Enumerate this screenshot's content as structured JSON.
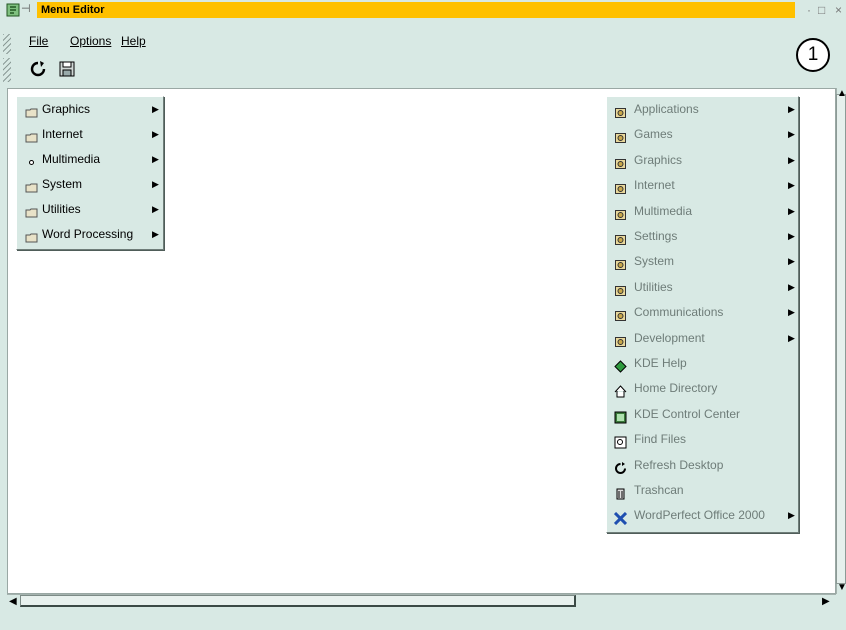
{
  "window": {
    "title": "Menu Editor",
    "buttons": {
      "minimize": "·",
      "maximize": "□",
      "close": "×"
    }
  },
  "menubar": {
    "file": "File",
    "options": "Options",
    "help": "Help"
  },
  "toolbar": {
    "refresh_icon": "refresh-icon",
    "save_icon": "save-icon"
  },
  "annotation_badge": "1",
  "left_menu": {
    "items": [
      {
        "label": "Graphics",
        "icon": "folder-icon"
      },
      {
        "label": "Internet",
        "icon": "folder-icon"
      },
      {
        "label": "Multimedia",
        "icon": "bullet-icon"
      },
      {
        "label": "System",
        "icon": "folder-icon"
      },
      {
        "label": "Utilities",
        "icon": "folder-icon"
      },
      {
        "label": "Word Processing",
        "icon": "folder-icon"
      }
    ]
  },
  "right_menu": {
    "items": [
      {
        "label": "Applications",
        "icon": "applications-icon",
        "submenu": true
      },
      {
        "label": "Games",
        "icon": "games-icon",
        "submenu": true
      },
      {
        "label": "Graphics",
        "icon": "graphics-icon",
        "submenu": true
      },
      {
        "label": "Internet",
        "icon": "internet-icon",
        "submenu": true
      },
      {
        "label": "Multimedia",
        "icon": "multimedia-icon",
        "submenu": true
      },
      {
        "label": "Settings",
        "icon": "settings-icon",
        "submenu": true
      },
      {
        "label": "System",
        "icon": "system-icon",
        "submenu": true
      },
      {
        "label": "Utilities",
        "icon": "utilities-icon",
        "submenu": true
      },
      {
        "label": "Communications",
        "icon": "communications-icon",
        "submenu": true
      },
      {
        "label": "Development",
        "icon": "development-icon",
        "submenu": true
      },
      {
        "label": "KDE Help",
        "icon": "help-icon",
        "submenu": false
      },
      {
        "label": "Home Directory",
        "icon": "home-icon",
        "submenu": false
      },
      {
        "label": "KDE Control Center",
        "icon": "control-center-icon",
        "submenu": false
      },
      {
        "label": "Find Files",
        "icon": "find-icon",
        "submenu": false
      },
      {
        "label": "Refresh Desktop",
        "icon": "refresh-icon",
        "submenu": false
      },
      {
        "label": "Trashcan",
        "icon": "trash-icon",
        "submenu": false
      },
      {
        "label": "WordPerfect Office 2000",
        "icon": "wordperfect-icon",
        "submenu": true
      }
    ]
  },
  "colors": {
    "title_bg": "#ffc000",
    "chrome": "#d8e9e4",
    "disabled_text": "#6e7c78"
  }
}
